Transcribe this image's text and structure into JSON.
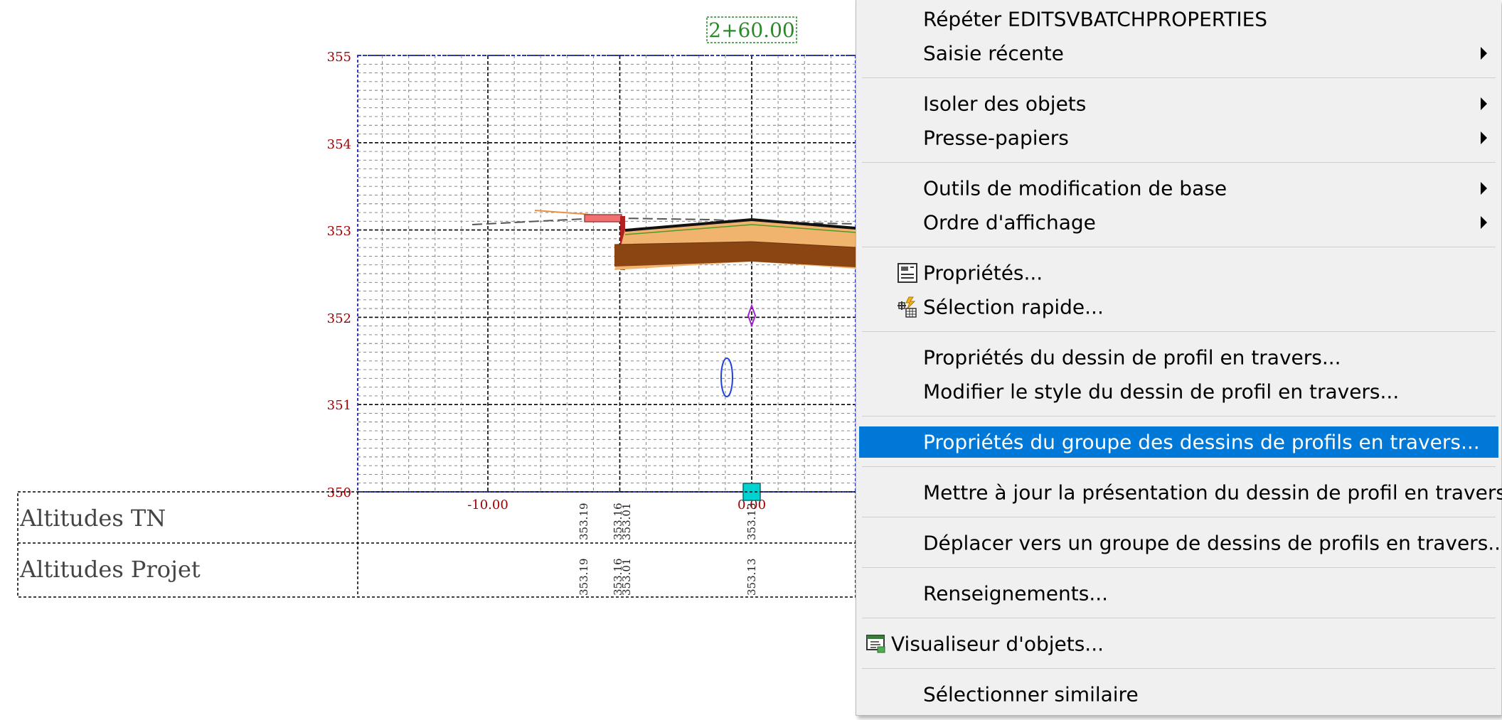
{
  "drawing": {
    "station_label": "2+60.00",
    "elevation_ticks": [
      "355",
      "354",
      "353",
      "352",
      "351",
      "350"
    ],
    "offset_labels": [
      "-10.00",
      "0.00"
    ],
    "bands": [
      {
        "title": "Altitudes TN",
        "values": [
          "353.19",
          "353.16",
          "353.01",
          "353.13"
        ]
      },
      {
        "title": "Altitudes Projet",
        "values": [
          "353.19",
          "353.16",
          "353.01",
          "353.13"
        ]
      }
    ],
    "colors": {
      "grid": "#000000",
      "tick_text": "#a00000",
      "viewport_border": "#2a3bbf",
      "station_box": "#2a8a2a",
      "layer_light": "#f0b46e",
      "layer_dark": "#8b4513",
      "grip": "#00d2d2"
    }
  },
  "context_menu": {
    "highlight_color": "#0078d7",
    "items": [
      {
        "label": "Répéter EDITSVBATCHPROPERTIES",
        "submenu": false,
        "icon": null
      },
      {
        "label": "Saisie récente",
        "submenu": true,
        "icon": null
      },
      {
        "label": "Isoler des objets",
        "submenu": true,
        "icon": null
      },
      {
        "label": "Presse-papiers",
        "submenu": true,
        "icon": null
      },
      {
        "label": "Outils de modification de base",
        "submenu": true,
        "icon": null
      },
      {
        "label": "Ordre d'affichage",
        "submenu": true,
        "icon": null
      },
      {
        "label": "Propriétés...",
        "submenu": false,
        "icon": "properties-icon"
      },
      {
        "label": "Sélection rapide...",
        "submenu": false,
        "icon": "quick-select-icon"
      },
      {
        "label": "Propriétés du dessin de profil en travers...",
        "submenu": false,
        "icon": null
      },
      {
        "label": "Modifier le style du dessin de profil en travers...",
        "submenu": false,
        "icon": null
      },
      {
        "label": "Propriétés du groupe des dessins de profils en travers...",
        "submenu": false,
        "icon": null,
        "highlighted": true
      },
      {
        "label": "Mettre à jour la présentation du dessin de profil en travers...",
        "submenu": false,
        "icon": null
      },
      {
        "label": "Déplacer vers un groupe de dessins de profils en travers...",
        "submenu": false,
        "icon": null
      },
      {
        "label": "Renseignements...",
        "submenu": false,
        "icon": null
      },
      {
        "label": "Visualiseur d'objets...",
        "submenu": false,
        "icon": "object-viewer-icon"
      },
      {
        "label": "Sélectionner similaire",
        "submenu": false,
        "icon": null
      }
    ]
  }
}
